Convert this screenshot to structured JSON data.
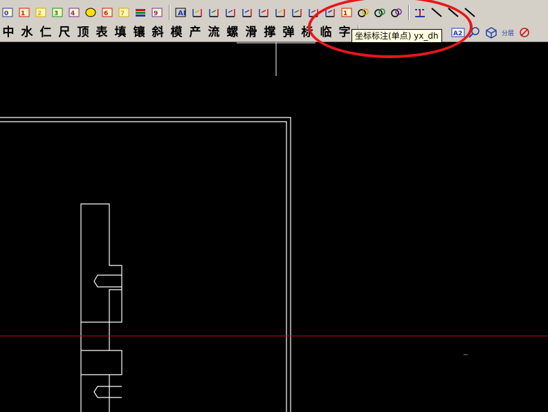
{
  "row1_icons": [
    "symbol-icon-1",
    "symbol-icon-2",
    "symbol-s8-icon",
    "symbol-a9-icon",
    "symbol-frame-icon",
    "ellipse-icon",
    "symbol-icon-7",
    "text-ao-icon",
    "layer-stack-icon",
    "text-grid-icon",
    "sep",
    "text-box-icon",
    "angle-dim-icon",
    "radius-dim-icon",
    "linear-dim-icon",
    "leader-icon",
    "baseline-dim-icon",
    "continuous-dim-icon",
    "ordinate-multi-icon",
    "ordinate-single-icon",
    "arc-dim-icon",
    "arc-length-icon",
    "chain-dim-icon",
    "chain-dim2-icon",
    "circle-dim-icon",
    "sep",
    "centerline-icon",
    "diagonal-line-icon",
    "diagonal-line2-icon",
    "diagonal-dashed-icon"
  ],
  "row2_chars": [
    "中",
    "水",
    "仁",
    "尺",
    "顶",
    "表",
    "填",
    "镶",
    "斜",
    "模",
    "产",
    "流",
    "螺",
    "滑",
    "撑",
    "弹",
    "标",
    "临",
    "字"
  ],
  "row2_right_icons": [
    "a2-text-icon",
    "zoom-icon",
    "cube-icon",
    "layer-split-icon",
    "layer-delete-icon"
  ],
  "row2_right_labels": {
    "a2": "A2",
    "split": "分层"
  },
  "tooltip": {
    "text": "坐标标注(单点) yx_dh"
  },
  "colors": {
    "toolbar_bg": "#d4d0c8",
    "canvas_bg": "#000000",
    "drawing_lines": "#ffffff",
    "crosshair_line": "#c8001e",
    "highlight": "#e8161a",
    "tooltip_bg": "#ffffe1"
  }
}
